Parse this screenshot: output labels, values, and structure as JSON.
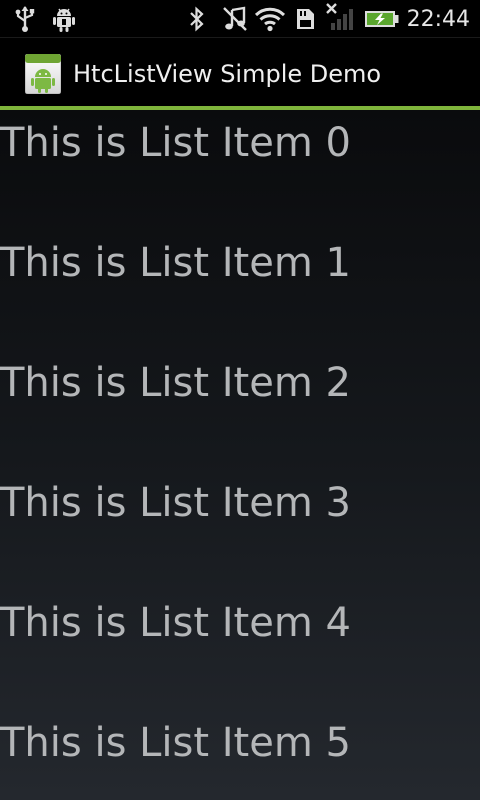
{
  "status_bar": {
    "time": "22:44",
    "icons": [
      "usb-icon",
      "android-debug-icon",
      "bluetooth-icon",
      "no-music-icon",
      "wifi-icon",
      "sd-card-icon",
      "no-signal-icon",
      "battery-charging-icon"
    ]
  },
  "app": {
    "title": "HtcListView Simple Demo",
    "icon": "android-app-icon",
    "accent_color": "#7fb43b"
  },
  "list": {
    "items": [
      {
        "label": "This is List Item 0"
      },
      {
        "label": "This is List Item 1"
      },
      {
        "label": "This is List Item 2"
      },
      {
        "label": "This is List Item 3"
      },
      {
        "label": "This is List Item 4"
      },
      {
        "label": "This is List Item 5"
      }
    ]
  }
}
